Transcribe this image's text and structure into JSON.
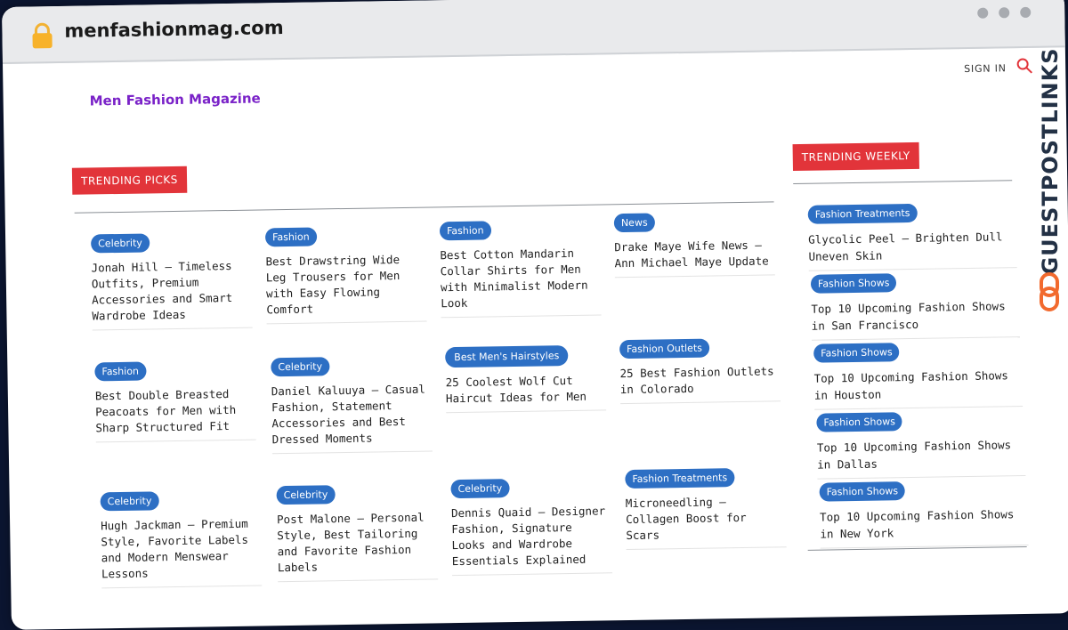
{
  "browser": {
    "url": "menfashionmag.com",
    "lock_icon": "lock-icon"
  },
  "header": {
    "brand": "Men Fashion Magazine",
    "sign_in": "SIGN IN",
    "search_icon": "search-icon"
  },
  "sections": {
    "trending_picks": "TRENDING PICKS",
    "trending_weekly": "TRENDING WEEKLY"
  },
  "columns": [
    [
      {
        "tag": "Celebrity",
        "title": "Jonah Hill – Timeless Outfits, Premium Accessories and Smart Wardrobe Ideas"
      },
      {
        "tag": "Fashion",
        "title": "Best Double Breasted Peacoats for Men with Sharp Structured Fit"
      },
      {
        "tag": "Celebrity",
        "title": "Hugh Jackman – Premium Style, Favorite Labels and Modern Menswear Lessons"
      }
    ],
    [
      {
        "tag": "Fashion",
        "title": "Best Drawstring Wide Leg Trousers for Men with Easy Flowing Comfort"
      },
      {
        "tag": "Celebrity",
        "title": "Daniel Kaluuya – Casual Fashion, Statement Accessories and Best Dressed Moments"
      },
      {
        "tag": "Celebrity",
        "title": "Post Malone – Personal Style, Best Tailoring and Favorite Fashion Labels"
      }
    ],
    [
      {
        "tag": "Fashion",
        "title": "Best Cotton Mandarin Collar Shirts for Men with Minimalist Modern Look"
      },
      {
        "tag": "Best Men's Hairstyles",
        "title": "25 Coolest Wolf Cut Haircut Ideas for Men"
      },
      {
        "tag": "Celebrity",
        "title": "Dennis Quaid – Designer Fashion, Signature Looks and Wardrobe Essentials Explained"
      }
    ],
    [
      {
        "tag": "News",
        "title": "Drake Maye Wife News – Ann Michael Maye Update"
      },
      {
        "tag": "Fashion Outlets",
        "title": "25 Best Fashion Outlets in Colorado"
      },
      {
        "tag": "Fashion Treatments",
        "title": "Microneedling – Collagen Boost for Scars"
      }
    ]
  ],
  "weekly": [
    {
      "tag": "Fashion Treatments",
      "title": "Glycolic Peel – Brighten Dull Uneven Skin"
    },
    {
      "tag": "Fashion Shows",
      "title": "Top 10 Upcoming Fashion Shows in San Francisco"
    },
    {
      "tag": "Fashion Shows",
      "title": "Top 10 Upcoming Fashion Shows in Houston"
    },
    {
      "tag": "Fashion Shows",
      "title": "Top 10 Upcoming Fashion Shows in Dallas"
    },
    {
      "tag": "Fashion Shows",
      "title": "Top 10 Upcoming Fashion Shows in New York"
    }
  ],
  "watermark": {
    "text": "GUESTPOSTLINKS",
    "logo_icon": "chain-link-icon"
  },
  "colors": {
    "brand": "#7a22c8",
    "section_label": "#e2343a",
    "tag": "#2d6fc4",
    "watermark_logo": "#f26a2e"
  }
}
